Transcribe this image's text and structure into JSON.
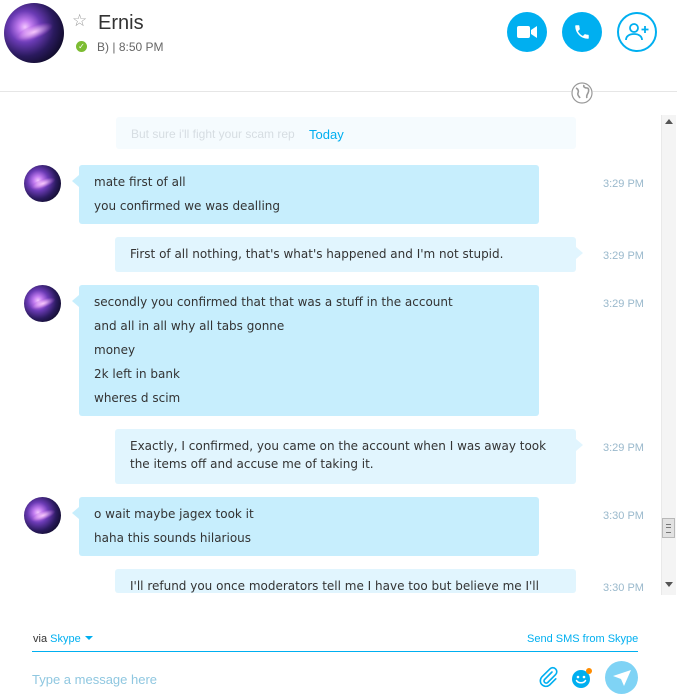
{
  "header": {
    "contact_name": "Ernis",
    "mood": "B)",
    "separator": "|",
    "last_seen": "8:50 PM",
    "icons": {
      "favorite": "star-outline-icon",
      "status": "online-check-icon",
      "video": "video-camera-icon",
      "call": "phone-icon",
      "add_people": "add-contact-icon",
      "globe": "globe-icon"
    }
  },
  "chat": {
    "faded_preview": "But sure i'll fight your scam rep",
    "date_divider": "Today",
    "messages": [
      {
        "direction": "incoming",
        "time": "3:29 PM",
        "lines": [
          "mate first of all",
          "you confirmed we was dealling"
        ]
      },
      {
        "direction": "outgoing",
        "time": "3:29 PM",
        "lines": [
          "First of all nothing, that's what's happened and I'm not stupid."
        ]
      },
      {
        "direction": "incoming",
        "time": "3:29 PM",
        "lines": [
          "secondly you confirmed that that was a stuff in the account",
          "and all in all why all tabs gonne",
          "money",
          "2k left in bank",
          "wheres d scim"
        ]
      },
      {
        "direction": "outgoing",
        "time": "3:29 PM",
        "lines": [
          "Exactly, I confirmed, you came on the account when I was away took",
          "the items off and accuse me of taking it."
        ]
      },
      {
        "direction": "incoming",
        "time": "3:30 PM",
        "lines": [
          "o wait maybe jagex took it",
          "haha this sounds hilarious"
        ]
      },
      {
        "direction": "outgoing",
        "time": "3:30 PM",
        "lines": [
          "I'll refund you once moderators tell me I have too but believe me I'll"
        ]
      }
    ]
  },
  "footer": {
    "via_label": "via",
    "via_service": "Skype",
    "sms_link": "Send SMS from Skype",
    "compose_placeholder": "Type a message here",
    "icons": {
      "attach": "paperclip-icon",
      "emoji": "emoticon-icon",
      "send": "send-icon"
    }
  },
  "colors": {
    "accent": "#00aff0",
    "incoming_bubble": "#c7eefd",
    "outgoing_bubble": "#e1f5fe",
    "online": "#7cbc32",
    "timestamp": "#9ab9cc"
  }
}
